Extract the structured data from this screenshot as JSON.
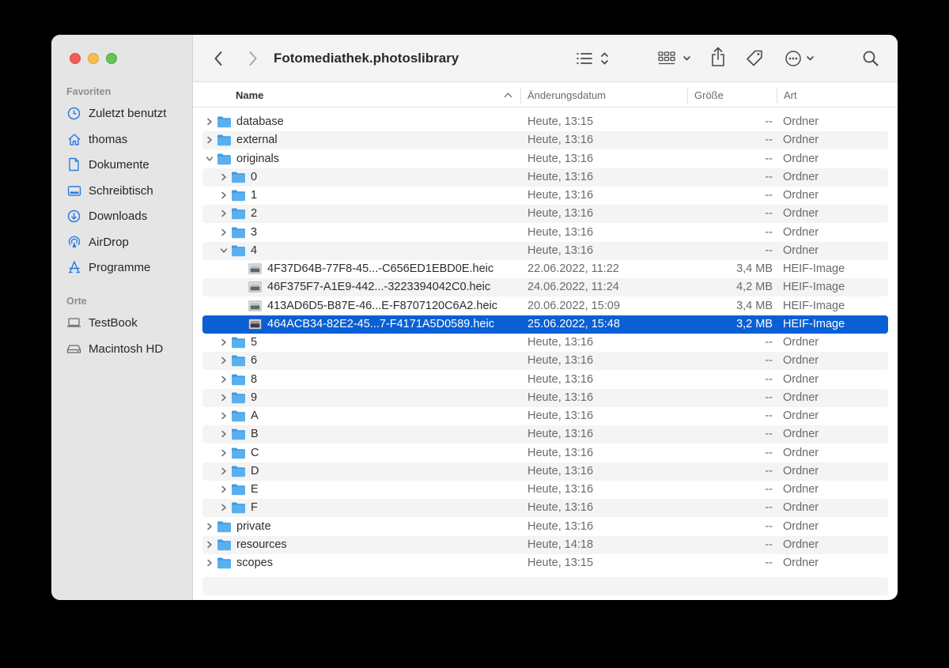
{
  "window": {
    "title": "Fotomediathek.photoslibrary"
  },
  "sidebar": {
    "favorites_title": "Favoriten",
    "favorites": [
      {
        "label": "Zuletzt benutzt",
        "icon": "clock-icon"
      },
      {
        "label": "thomas",
        "icon": "home-icon"
      },
      {
        "label": "Dokumente",
        "icon": "document-icon"
      },
      {
        "label": "Schreibtisch",
        "icon": "desktop-icon"
      },
      {
        "label": "Downloads",
        "icon": "download-icon"
      },
      {
        "label": "AirDrop",
        "icon": "airdrop-icon"
      },
      {
        "label": "Programme",
        "icon": "apps-icon"
      }
    ],
    "locations_title": "Orte",
    "locations": [
      {
        "label": "TestBook",
        "icon": "laptop-icon"
      },
      {
        "label": "Macintosh HD",
        "icon": "drive-icon"
      }
    ]
  },
  "columns": {
    "name": "Name",
    "date": "Änderungsdatum",
    "size": "Größe",
    "kind": "Art"
  },
  "rows": [
    {
      "name": "database",
      "date": "Heute, 13:15",
      "size": "--",
      "kind": "Ordner",
      "level": 0,
      "type": "folder",
      "expanded": false
    },
    {
      "name": "external",
      "date": "Heute, 13:16",
      "size": "--",
      "kind": "Ordner",
      "level": 0,
      "type": "folder",
      "expanded": false
    },
    {
      "name": "originals",
      "date": "Heute, 13:16",
      "size": "--",
      "kind": "Ordner",
      "level": 0,
      "type": "folder",
      "expanded": true
    },
    {
      "name": "0",
      "date": "Heute, 13:16",
      "size": "--",
      "kind": "Ordner",
      "level": 1,
      "type": "folder",
      "expanded": false
    },
    {
      "name": "1",
      "date": "Heute, 13:16",
      "size": "--",
      "kind": "Ordner",
      "level": 1,
      "type": "folder",
      "expanded": false
    },
    {
      "name": "2",
      "date": "Heute, 13:16",
      "size": "--",
      "kind": "Ordner",
      "level": 1,
      "type": "folder",
      "expanded": false
    },
    {
      "name": "3",
      "date": "Heute, 13:16",
      "size": "--",
      "kind": "Ordner",
      "level": 1,
      "type": "folder",
      "expanded": false
    },
    {
      "name": "4",
      "date": "Heute, 13:16",
      "size": "--",
      "kind": "Ordner",
      "level": 1,
      "type": "folder",
      "expanded": true
    },
    {
      "name": "4F37D64B-77F8-45...-C656ED1EBD0E.heic",
      "date": "22.06.2022, 11:22",
      "size": "3,4 MB",
      "kind": "HEIF-Image",
      "level": 2,
      "type": "file"
    },
    {
      "name": "46F375F7-A1E9-442...-3223394042C0.heic",
      "date": "24.06.2022, 11:24",
      "size": "4,2 MB",
      "kind": "HEIF-Image",
      "level": 2,
      "type": "file"
    },
    {
      "name": "413AD6D5-B87E-46...E-F8707120C6A2.heic",
      "date": "20.06.2022, 15:09",
      "size": "3,4 MB",
      "kind": "HEIF-Image",
      "level": 2,
      "type": "file"
    },
    {
      "name": "464ACB34-82E2-45...7-F4171A5D0589.heic",
      "date": "25.06.2022, 15:48",
      "size": "3,2 MB",
      "kind": "HEIF-Image",
      "level": 2,
      "type": "file",
      "selected": true
    },
    {
      "name": "5",
      "date": "Heute, 13:16",
      "size": "--",
      "kind": "Ordner",
      "level": 1,
      "type": "folder",
      "expanded": false
    },
    {
      "name": "6",
      "date": "Heute, 13:16",
      "size": "--",
      "kind": "Ordner",
      "level": 1,
      "type": "folder",
      "expanded": false
    },
    {
      "name": "8",
      "date": "Heute, 13:16",
      "size": "--",
      "kind": "Ordner",
      "level": 1,
      "type": "folder",
      "expanded": false
    },
    {
      "name": "9",
      "date": "Heute, 13:16",
      "size": "--",
      "kind": "Ordner",
      "level": 1,
      "type": "folder",
      "expanded": false
    },
    {
      "name": "A",
      "date": "Heute, 13:16",
      "size": "--",
      "kind": "Ordner",
      "level": 1,
      "type": "folder",
      "expanded": false
    },
    {
      "name": "B",
      "date": "Heute, 13:16",
      "size": "--",
      "kind": "Ordner",
      "level": 1,
      "type": "folder",
      "expanded": false
    },
    {
      "name": "C",
      "date": "Heute, 13:16",
      "size": "--",
      "kind": "Ordner",
      "level": 1,
      "type": "folder",
      "expanded": false
    },
    {
      "name": "D",
      "date": "Heute, 13:16",
      "size": "--",
      "kind": "Ordner",
      "level": 1,
      "type": "folder",
      "expanded": false
    },
    {
      "name": "E",
      "date": "Heute, 13:16",
      "size": "--",
      "kind": "Ordner",
      "level": 1,
      "type": "folder",
      "expanded": false
    },
    {
      "name": "F",
      "date": "Heute, 13:16",
      "size": "--",
      "kind": "Ordner",
      "level": 1,
      "type": "folder",
      "expanded": false
    },
    {
      "name": "private",
      "date": "Heute, 13:16",
      "size": "--",
      "kind": "Ordner",
      "level": 0,
      "type": "folder",
      "expanded": false
    },
    {
      "name": "resources",
      "date": "Heute, 14:18",
      "size": "--",
      "kind": "Ordner",
      "level": 0,
      "type": "folder",
      "expanded": false
    },
    {
      "name": "scopes",
      "date": "Heute, 13:15",
      "size": "--",
      "kind": "Ordner",
      "level": 0,
      "type": "folder",
      "expanded": false
    }
  ],
  "colors": {
    "selection": "#0a5fd5",
    "folder": "#5ab0ee",
    "folder_tab": "#3f9be3"
  }
}
